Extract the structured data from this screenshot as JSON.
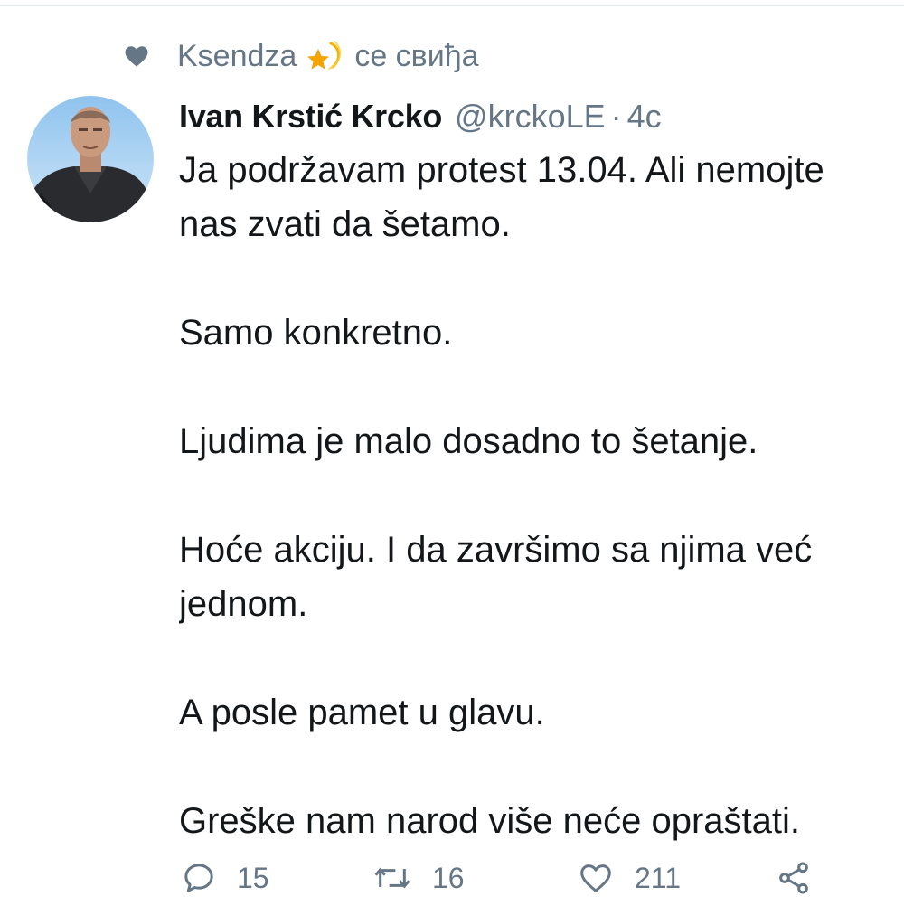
{
  "social_context": {
    "icon": "heart-icon",
    "liker": "Ksendza",
    "emoji": "shooting-star-emoji",
    "action_text": "се свиђа"
  },
  "tweet": {
    "avatar": "profile-photo",
    "display_name": "Ivan Krstić  Krcko",
    "handle": "@krckoLE",
    "separator": "·",
    "timestamp": "4c",
    "paragraphs": [
      "Ja podržavam protest 13.04. Ali nemojte",
      "nas zvati da šetamo.",
      "Samo konkretno.",
      "Ljudima je malo dosadno to šetanje.",
      "Hoće akciju. I da završimo sa njima već",
      "jednom.",
      "A posle pamet u glavu.",
      "Greške nam narod više neće opraštati."
    ]
  },
  "actions": {
    "reply": {
      "icon": "reply-icon",
      "count": "15"
    },
    "retweet": {
      "icon": "retweet-icon",
      "count": "16"
    },
    "like": {
      "icon": "like-heart-icon",
      "count": "211"
    },
    "share": {
      "icon": "share-icon"
    }
  },
  "colors": {
    "text_primary": "#14171a",
    "text_secondary": "#657786",
    "icon_gray": "#657786"
  }
}
